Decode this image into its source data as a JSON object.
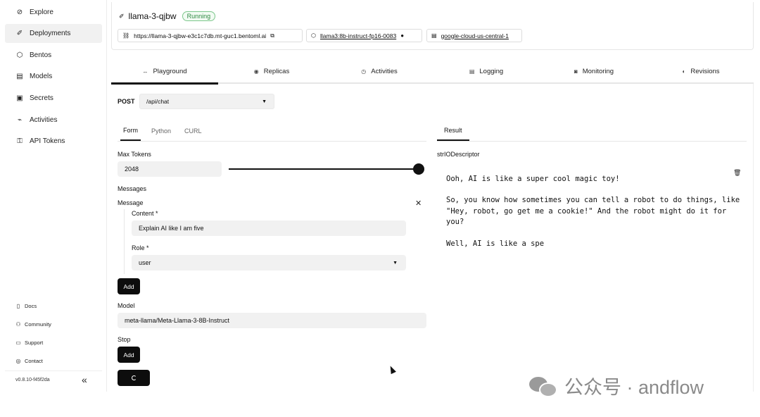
{
  "sidebar": {
    "items": [
      {
        "label": "Explore",
        "icon": "compass-icon",
        "glyph": "⊘"
      },
      {
        "label": "Deployments",
        "icon": "rocket-icon",
        "glyph": "✐"
      },
      {
        "label": "Bentos",
        "icon": "cube-icon",
        "glyph": "⬡"
      },
      {
        "label": "Models",
        "icon": "file-icon",
        "glyph": "▤"
      },
      {
        "label": "Secrets",
        "icon": "key-box-icon",
        "glyph": "▣"
      },
      {
        "label": "Activities",
        "icon": "activity-icon",
        "glyph": "⌁"
      },
      {
        "label": "API Tokens",
        "icon": "key-icon",
        "glyph": "⚿"
      }
    ],
    "footer": [
      {
        "label": "Docs",
        "icon": "doc-icon",
        "glyph": "▯"
      },
      {
        "label": "Community",
        "icon": "people-icon",
        "glyph": "⚇"
      },
      {
        "label": "Support",
        "icon": "chat-icon",
        "glyph": "▭"
      },
      {
        "label": "Contact",
        "icon": "mail-icon",
        "glyph": "◎"
      }
    ],
    "version": "v0.8.10-f45f2da",
    "collapse_glyph": "«"
  },
  "header": {
    "title": "llama-3-qjbw",
    "status": "Running",
    "url": "https://llama-3-qjbw-e3c1c7db.mt-guc1.bentoml.ai",
    "bento": "llama3:8b-instruct-fp16-0083",
    "cluster": "google-cloud-us-central-1"
  },
  "tabs": [
    {
      "label": "Playground",
      "glyph": "↔"
    },
    {
      "label": "Replicas",
      "glyph": "◉"
    },
    {
      "label": "Activities",
      "glyph": "◷"
    },
    {
      "label": "Logging",
      "glyph": "▤"
    },
    {
      "label": "Monitoring",
      "glyph": "◙"
    },
    {
      "label": "Revisions",
      "glyph": "◐"
    }
  ],
  "request": {
    "method": "POST",
    "route": "/api/chat",
    "subtabs": [
      "Form",
      "Python",
      "CURL"
    ]
  },
  "form": {
    "max_tokens_label": "Max Tokens",
    "max_tokens_value": "2048",
    "max_tokens_slider_fraction": 1.0,
    "messages_label": "Messages",
    "message_label": "Message",
    "content_label": "Content *",
    "content_value": "Explain AI like I am five",
    "role_label": "Role *",
    "role_value": "user",
    "add_label": "Add",
    "model_label": "Model",
    "model_value": "meta-llama/Meta-Llama-3-8B-Instruct",
    "stop_label": "Stop",
    "stop_add_label": "Add"
  },
  "result": {
    "tab": "Result",
    "descriptor": "strIODescriptor",
    "lines": [
      "Ooh, AI is like a super cool magic toy!",
      "So, you know how sometimes you can tell a robot to do things, like\n\"Hey, robot, go get me a cookie!\" And the robot might do it for\nyou?",
      "Well, AI is like a spe"
    ]
  },
  "watermark": "公众号 · andflow"
}
